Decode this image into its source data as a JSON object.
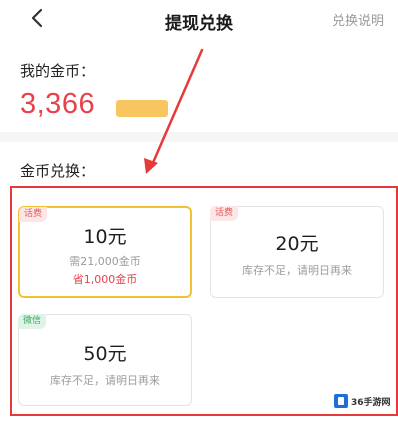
{
  "header": {
    "title": "提现兑换",
    "right_link": "兑换说明",
    "back_icon": "chevron-left-icon"
  },
  "coins": {
    "label": "我的金币：",
    "value": "3,366",
    "badge": ""
  },
  "exchange": {
    "label": "金币兑换：",
    "cards": [
      {
        "tag": "话费",
        "tag_color": "#e35d5d",
        "amount": "10元",
        "line1": "需21,000金币",
        "line2": "省1,000金币",
        "selected": true
      },
      {
        "tag": "话费",
        "tag_color": "#e35d5d",
        "amount": "20元",
        "line1": "库存不足，请明日再来",
        "line2": "",
        "selected": false
      },
      {
        "tag": "微信",
        "tag_color": "#3aa860",
        "amount": "50元",
        "line1": "库存不足，请明日再来",
        "line2": "",
        "selected": false
      }
    ]
  },
  "watermark": {
    "text": "36手游网"
  },
  "colors": {
    "accent_red": "#e8414a",
    "selected_border": "#f2c230",
    "annotation_red": "#e63a3a"
  }
}
